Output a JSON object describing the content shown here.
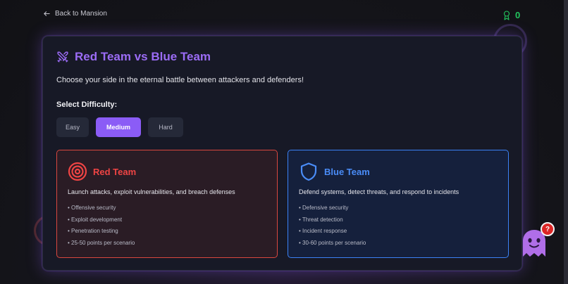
{
  "nav": {
    "back_label": "Back to Mansion"
  },
  "score": {
    "value": "0",
    "icon": "award-icon"
  },
  "challenge": {
    "title": "Red Team vs Blue Team",
    "subtitle": "Choose your side in the eternal battle between attackers and defenders!",
    "difficulty_label": "Select Difficulty:",
    "difficulties": [
      "Easy",
      "Medium",
      "Hard"
    ],
    "selected_difficulty": "Medium"
  },
  "teams": {
    "red": {
      "name": "Red Team",
      "description": "Launch attacks, exploit vulnerabilities, and breach defenses",
      "features": [
        "Offensive security",
        "Exploit development",
        "Penetration testing",
        "25-50 points per scenario"
      ],
      "color": "#ef4444",
      "icon": "target-icon"
    },
    "blue": {
      "name": "Blue Team",
      "description": "Defend systems, detect threats, and respond to incidents",
      "features": [
        "Defensive security",
        "Threat detection",
        "Incident response",
        "30-60 points per scenario"
      ],
      "color": "#3b82f6",
      "icon": "shield-icon"
    }
  },
  "help": {
    "badge": "?"
  },
  "colors": {
    "accent": "#8b5cf6",
    "score": "#22c55e"
  }
}
